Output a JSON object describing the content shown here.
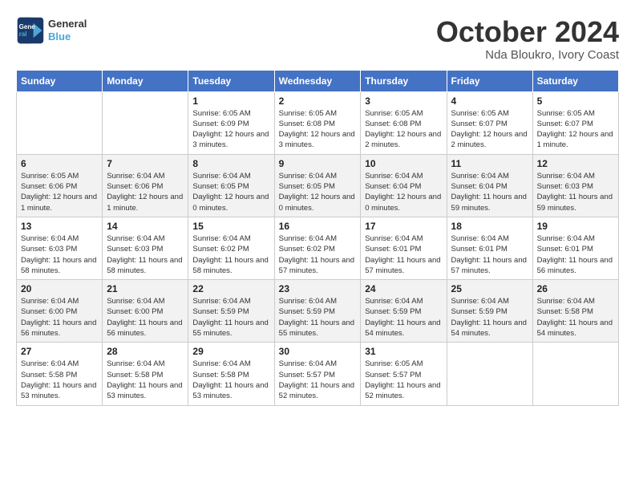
{
  "header": {
    "logo_line1": "General",
    "logo_line2": "Blue",
    "month_title": "October 2024",
    "location": "Nda Bloukro, Ivory Coast"
  },
  "weekdays": [
    "Sunday",
    "Monday",
    "Tuesday",
    "Wednesday",
    "Thursday",
    "Friday",
    "Saturday"
  ],
  "weeks": [
    [
      {
        "day": "",
        "info": ""
      },
      {
        "day": "",
        "info": ""
      },
      {
        "day": "1",
        "info": "Sunrise: 6:05 AM\nSunset: 6:09 PM\nDaylight: 12 hours and 3 minutes."
      },
      {
        "day": "2",
        "info": "Sunrise: 6:05 AM\nSunset: 6:08 PM\nDaylight: 12 hours and 3 minutes."
      },
      {
        "day": "3",
        "info": "Sunrise: 6:05 AM\nSunset: 6:08 PM\nDaylight: 12 hours and 2 minutes."
      },
      {
        "day": "4",
        "info": "Sunrise: 6:05 AM\nSunset: 6:07 PM\nDaylight: 12 hours and 2 minutes."
      },
      {
        "day": "5",
        "info": "Sunrise: 6:05 AM\nSunset: 6:07 PM\nDaylight: 12 hours and 1 minute."
      }
    ],
    [
      {
        "day": "6",
        "info": "Sunrise: 6:05 AM\nSunset: 6:06 PM\nDaylight: 12 hours and 1 minute."
      },
      {
        "day": "7",
        "info": "Sunrise: 6:04 AM\nSunset: 6:06 PM\nDaylight: 12 hours and 1 minute."
      },
      {
        "day": "8",
        "info": "Sunrise: 6:04 AM\nSunset: 6:05 PM\nDaylight: 12 hours and 0 minutes."
      },
      {
        "day": "9",
        "info": "Sunrise: 6:04 AM\nSunset: 6:05 PM\nDaylight: 12 hours and 0 minutes."
      },
      {
        "day": "10",
        "info": "Sunrise: 6:04 AM\nSunset: 6:04 PM\nDaylight: 12 hours and 0 minutes."
      },
      {
        "day": "11",
        "info": "Sunrise: 6:04 AM\nSunset: 6:04 PM\nDaylight: 11 hours and 59 minutes."
      },
      {
        "day": "12",
        "info": "Sunrise: 6:04 AM\nSunset: 6:03 PM\nDaylight: 11 hours and 59 minutes."
      }
    ],
    [
      {
        "day": "13",
        "info": "Sunrise: 6:04 AM\nSunset: 6:03 PM\nDaylight: 11 hours and 58 minutes."
      },
      {
        "day": "14",
        "info": "Sunrise: 6:04 AM\nSunset: 6:03 PM\nDaylight: 11 hours and 58 minutes."
      },
      {
        "day": "15",
        "info": "Sunrise: 6:04 AM\nSunset: 6:02 PM\nDaylight: 11 hours and 58 minutes."
      },
      {
        "day": "16",
        "info": "Sunrise: 6:04 AM\nSunset: 6:02 PM\nDaylight: 11 hours and 57 minutes."
      },
      {
        "day": "17",
        "info": "Sunrise: 6:04 AM\nSunset: 6:01 PM\nDaylight: 11 hours and 57 minutes."
      },
      {
        "day": "18",
        "info": "Sunrise: 6:04 AM\nSunset: 6:01 PM\nDaylight: 11 hours and 57 minutes."
      },
      {
        "day": "19",
        "info": "Sunrise: 6:04 AM\nSunset: 6:01 PM\nDaylight: 11 hours and 56 minutes."
      }
    ],
    [
      {
        "day": "20",
        "info": "Sunrise: 6:04 AM\nSunset: 6:00 PM\nDaylight: 11 hours and 56 minutes."
      },
      {
        "day": "21",
        "info": "Sunrise: 6:04 AM\nSunset: 6:00 PM\nDaylight: 11 hours and 56 minutes."
      },
      {
        "day": "22",
        "info": "Sunrise: 6:04 AM\nSunset: 5:59 PM\nDaylight: 11 hours and 55 minutes."
      },
      {
        "day": "23",
        "info": "Sunrise: 6:04 AM\nSunset: 5:59 PM\nDaylight: 11 hours and 55 minutes."
      },
      {
        "day": "24",
        "info": "Sunrise: 6:04 AM\nSunset: 5:59 PM\nDaylight: 11 hours and 54 minutes."
      },
      {
        "day": "25",
        "info": "Sunrise: 6:04 AM\nSunset: 5:59 PM\nDaylight: 11 hours and 54 minutes."
      },
      {
        "day": "26",
        "info": "Sunrise: 6:04 AM\nSunset: 5:58 PM\nDaylight: 11 hours and 54 minutes."
      }
    ],
    [
      {
        "day": "27",
        "info": "Sunrise: 6:04 AM\nSunset: 5:58 PM\nDaylight: 11 hours and 53 minutes."
      },
      {
        "day": "28",
        "info": "Sunrise: 6:04 AM\nSunset: 5:58 PM\nDaylight: 11 hours and 53 minutes."
      },
      {
        "day": "29",
        "info": "Sunrise: 6:04 AM\nSunset: 5:58 PM\nDaylight: 11 hours and 53 minutes."
      },
      {
        "day": "30",
        "info": "Sunrise: 6:04 AM\nSunset: 5:57 PM\nDaylight: 11 hours and 52 minutes."
      },
      {
        "day": "31",
        "info": "Sunrise: 6:05 AM\nSunset: 5:57 PM\nDaylight: 11 hours and 52 minutes."
      },
      {
        "day": "",
        "info": ""
      },
      {
        "day": "",
        "info": ""
      }
    ]
  ]
}
